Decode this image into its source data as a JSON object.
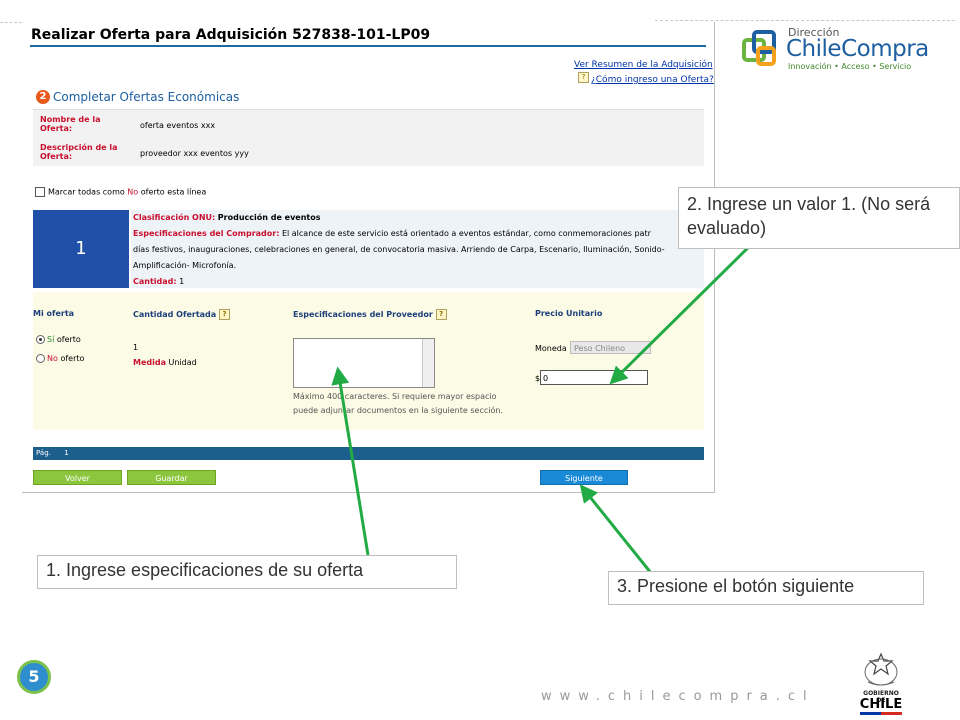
{
  "title": "Realizar Oferta para Adquisición 527838-101-LP09",
  "links": {
    "resumen": "Ver Resumen de la Adquisición",
    "como_ingreso": "¿Cómo ingreso una Oferta?"
  },
  "step": {
    "number": "2",
    "label": "Completar Ofertas Económicas"
  },
  "info": {
    "nombre_label": "Nombre de la Oferta:",
    "nombre_value": "oferta eventos xxx",
    "descripcion_label": "Descripción de la Oferta:",
    "descripcion_value": "proveedor xxx eventos yyy"
  },
  "mark_all": {
    "pre": "Marcar todas como ",
    "no": "No",
    "post": " oferto esta línea"
  },
  "line": {
    "number": "1",
    "clasificacion_label": "Clasificación ONU:",
    "clasificacion_value": "Producción de eventos",
    "especificaciones_label": "Especificaciones del Comprador:",
    "especificaciones_line1": "El alcance de este servicio está orientado a eventos estándar, como conmemoraciones patr",
    "especificaciones_line2": "días festivos, inauguraciones, celebraciones en general, de convocatoria masiva. Arriendo de Carpa, Escenario, Iluminación, Sonido-",
    "especificaciones_line3": "Amplificación- Microfonía.",
    "cantidad_label": "Cantidad:",
    "cantidad_value": "1"
  },
  "offer": {
    "col_mi_oferta": "Mi oferta",
    "col_cantidad": "Cantidad Ofertada",
    "col_especificaciones": "Especificaciones del Proveedor",
    "col_precio": "Precio Unitario",
    "si": "Sí",
    "oferto": "oferto",
    "no": "No",
    "cantidad_value": "1",
    "medida_label": "Medida",
    "medida_value": "Unidad",
    "hint_line1": "Máximo 400 caracteres. Si requiere mayor espacio",
    "hint_line2": "puede adjuntar documentos en la siguiente sección.",
    "moneda_label": "Moneda",
    "moneda_value": "Peso Chileno",
    "currency_symbol": "$",
    "price_value": "0"
  },
  "pager": {
    "label": "Pág.",
    "value": "1"
  },
  "buttons": {
    "volver": "Volver",
    "guardar": "Guardar",
    "siguiente": "Siguiente"
  },
  "callouts": {
    "c1": "1. Ingrese especificaciones de su oferta",
    "c2": "2. Ingrese un valor 1. (No será evaluado)",
    "c3": "3. Presione el botón siguiente"
  },
  "logo": {
    "direccion": "Dirección",
    "name": "ChileCompra",
    "tagline": "Innovación • Acceso • Servicio"
  },
  "slide_number": "5",
  "website": "www.chilecompra.cl",
  "gobierno": {
    "label": "GOBIERNO DE",
    "name": "CHILE"
  },
  "colors": {
    "accent_blue": "#1d5fa1",
    "alert_red": "#c8102e",
    "button_green": "#8cc63f",
    "arrow_green": "#22aa44"
  }
}
